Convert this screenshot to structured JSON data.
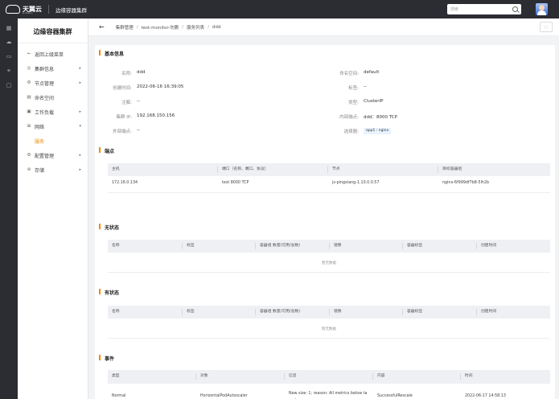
{
  "topbar": {
    "logo_text": "天翼云",
    "logo_sub": "e.cloud.cn",
    "product": "边缘容器集群",
    "search_placeholder": "搜索"
  },
  "sidebar": {
    "title": "边缘容器集群",
    "items": [
      {
        "label": "返回上级菜单",
        "icon": "arrow-left-icon",
        "arrow": ""
      },
      {
        "label": "集群信息",
        "icon": "cluster-icon",
        "arrow": "▸"
      },
      {
        "label": "节点管理",
        "icon": "node-icon",
        "arrow": "▸"
      },
      {
        "label": "命名空间",
        "icon": "namespace-icon",
        "arrow": ""
      },
      {
        "label": "工作负载",
        "icon": "workload-icon",
        "arrow": "▸"
      },
      {
        "label": "网络",
        "icon": "network-icon",
        "arrow": "▾"
      },
      {
        "label": "服务",
        "icon": "",
        "arrow": ""
      },
      {
        "label": "配置管理",
        "icon": "config-icon",
        "arrow": "▸"
      },
      {
        "label": "存储",
        "icon": "storage-icon",
        "arrow": "▸"
      }
    ]
  },
  "breadcrumb": [
    "集群管理",
    "test-monitor-勿删",
    "服务列表",
    "ddd"
  ],
  "basic": {
    "title": "基本信息",
    "left": [
      {
        "k": "名称:",
        "v": "ddd"
      },
      {
        "k": "创建时间:",
        "v": "2022-06-16 16:39:05"
      },
      {
        "k": "注解:",
        "v": "--"
      },
      {
        "k": "集群 IP:",
        "v": "192.168.150.156"
      },
      {
        "k": "外部端点:",
        "v": "--"
      }
    ],
    "right": [
      {
        "k": "命名空间:",
        "v": "default"
      },
      {
        "k": "标签:",
        "v": "--"
      },
      {
        "k": "类型:",
        "v": "ClusterIP"
      },
      {
        "k": "内部端点:",
        "v": "ddd：8000 TCP"
      },
      {
        "k": "选择器:",
        "v": "app1 : nginx"
      }
    ]
  },
  "endpoints": {
    "title": "端点",
    "headers": [
      "主机",
      "端口（名称、端口、协议）",
      "节点",
      "目标容器组"
    ],
    "rows": [
      [
        "172.16.0.134",
        "test 8000 TCP",
        "js-pingxiang-1.10.0.0.57",
        "nginx-6f999df7b8-5lh2b"
      ]
    ]
  },
  "stateless": {
    "title": "无状态",
    "headers": [
      "名称",
      "标签",
      "容器组 数量(可用/总数)",
      "镜像",
      "容器标签",
      "创建时间"
    ],
    "empty": "暂无数据"
  },
  "stateful": {
    "title": "有状态",
    "headers": [
      "名称",
      "标签",
      "容器组 数量(可用/总数)",
      "镜像",
      "容器标签",
      "创建时间"
    ],
    "empty": "暂无数据"
  },
  "events": {
    "title": "事件",
    "headers": [
      "类型",
      "对象",
      "信息",
      "内容",
      "时间"
    ],
    "rows": [
      [
        "Normal",
        "HorizontalPodAutoscaler",
        "New size: 1; reason: All metrics below ta\nrget",
        "SuccessfulRescale",
        "2022-06-17 14:58:13"
      ]
    ]
  },
  "colors": {
    "accent": "#f18a00",
    "topbar": "#2b2d33"
  }
}
